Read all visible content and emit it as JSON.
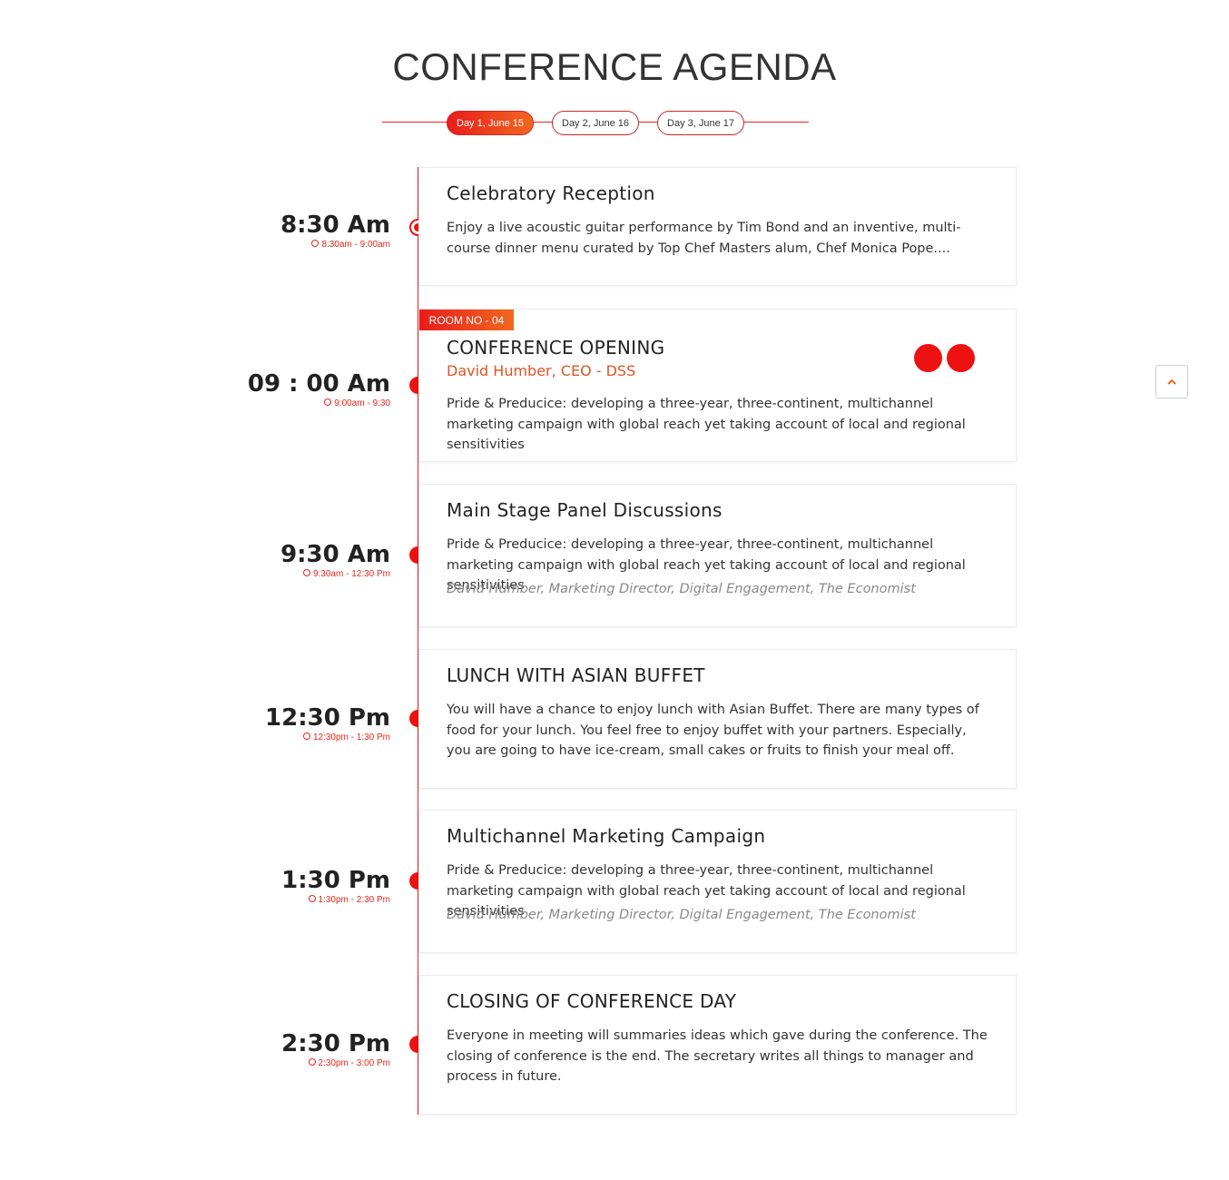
{
  "page": {
    "title": "CONFERENCE AGENDA"
  },
  "tabs": [
    {
      "label": "Day 1, June 15",
      "active": true
    },
    {
      "label": "Day 2, June 16",
      "active": false
    },
    {
      "label": "Day 3, June 17",
      "active": false
    }
  ],
  "colors": {
    "accent": "#ee1111",
    "accent_gradient_end": "#f2681f",
    "speaker": "#e25424"
  },
  "sessions": [
    {
      "time": "8:30 Am",
      "range": "8:30am - 9:00am",
      "title": "Celebratory Reception",
      "description": "Enjoy a live acoustic guitar performance by Tim Bond and an inventive, multi-course dinner menu curated by Top Chef Masters alum, Chef Monica Pope...."
    },
    {
      "time": "09 : 00 Am",
      "range": "9:00am - 9:30",
      "room": "ROOM NO - 04",
      "title": "CONFERENCE OPENING",
      "speaker": "David Humber, CEO - DSS",
      "description": "Pride & Preducice: developing a three-year, three-continent, multichannel marketing campaign with global reach yet taking account of local and regional sensitivities"
    },
    {
      "time": "9:30 Am",
      "range": "9:30am - 12:30 Pm",
      "title": "Main Stage Panel Discussions",
      "description": "Pride & Preducice: developing a three-year, three-continent, multichannel marketing campaign with global reach yet taking account of local and regional sensitivities",
      "speaker": "David Humber, Marketing Director, Digital Engagement, The Economist"
    },
    {
      "time": "12:30 Pm",
      "range": "12:30pm - 1:30 Pm",
      "title": "LUNCH WITH ASIAN BUFFET",
      "description": "You will have a chance to enjoy lunch with Asian Buffet. There are many types of food for your lunch. You feel free to enjoy buffet with your partners. Especially, you are going to have ice-cream, small cakes or fruits to finish your meal off."
    },
    {
      "time": "1:30 Pm",
      "range": "1:30pm - 2:30 Pm",
      "title": "Multichannel Marketing Campaign",
      "description": "Pride & Preducice: developing a three-year, three-continent, multichannel marketing campaign with global reach yet taking account of local and regional sensitivities",
      "speaker": "David Humber, Marketing Director, Digital Engagement, The Economist"
    },
    {
      "time": "2:30 Pm",
      "range": "2:30pm - 3:00 Pm",
      "title": "CLOSING OF CONFERENCE DAY",
      "description": "Everyone in meeting will summaries ideas which gave during the conference. The closing of conference is the end. The secretary writes all things to manager and process in future."
    }
  ],
  "icons": {
    "clock": "clock-icon",
    "scroll_top": "chevron-up-icon"
  }
}
